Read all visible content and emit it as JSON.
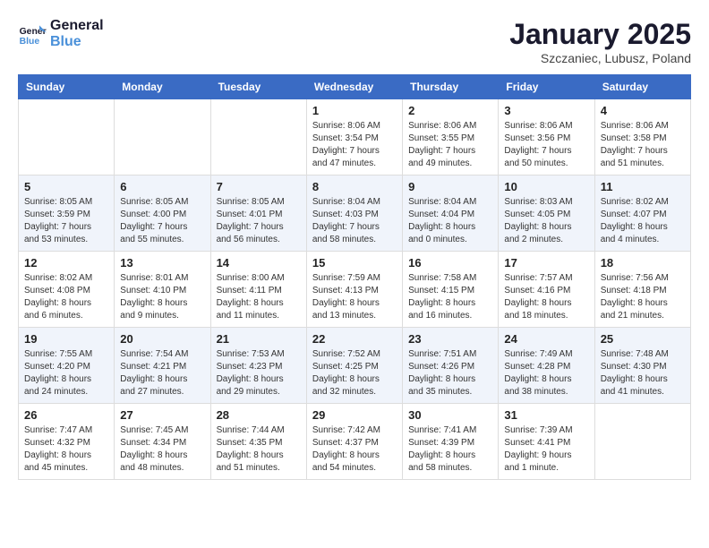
{
  "logo": {
    "line1": "General",
    "line2": "Blue"
  },
  "title": "January 2025",
  "subtitle": "Szczaniec, Lubusz, Poland",
  "weekdays": [
    "Sunday",
    "Monday",
    "Tuesday",
    "Wednesday",
    "Thursday",
    "Friday",
    "Saturday"
  ],
  "weeks": [
    [
      {
        "day": "",
        "info": ""
      },
      {
        "day": "",
        "info": ""
      },
      {
        "day": "",
        "info": ""
      },
      {
        "day": "1",
        "info": "Sunrise: 8:06 AM\nSunset: 3:54 PM\nDaylight: 7 hours\nand 47 minutes."
      },
      {
        "day": "2",
        "info": "Sunrise: 8:06 AM\nSunset: 3:55 PM\nDaylight: 7 hours\nand 49 minutes."
      },
      {
        "day": "3",
        "info": "Sunrise: 8:06 AM\nSunset: 3:56 PM\nDaylight: 7 hours\nand 50 minutes."
      },
      {
        "day": "4",
        "info": "Sunrise: 8:06 AM\nSunset: 3:58 PM\nDaylight: 7 hours\nand 51 minutes."
      }
    ],
    [
      {
        "day": "5",
        "info": "Sunrise: 8:05 AM\nSunset: 3:59 PM\nDaylight: 7 hours\nand 53 minutes."
      },
      {
        "day": "6",
        "info": "Sunrise: 8:05 AM\nSunset: 4:00 PM\nDaylight: 7 hours\nand 55 minutes."
      },
      {
        "day": "7",
        "info": "Sunrise: 8:05 AM\nSunset: 4:01 PM\nDaylight: 7 hours\nand 56 minutes."
      },
      {
        "day": "8",
        "info": "Sunrise: 8:04 AM\nSunset: 4:03 PM\nDaylight: 7 hours\nand 58 minutes."
      },
      {
        "day": "9",
        "info": "Sunrise: 8:04 AM\nSunset: 4:04 PM\nDaylight: 8 hours\nand 0 minutes."
      },
      {
        "day": "10",
        "info": "Sunrise: 8:03 AM\nSunset: 4:05 PM\nDaylight: 8 hours\nand 2 minutes."
      },
      {
        "day": "11",
        "info": "Sunrise: 8:02 AM\nSunset: 4:07 PM\nDaylight: 8 hours\nand 4 minutes."
      }
    ],
    [
      {
        "day": "12",
        "info": "Sunrise: 8:02 AM\nSunset: 4:08 PM\nDaylight: 8 hours\nand 6 minutes."
      },
      {
        "day": "13",
        "info": "Sunrise: 8:01 AM\nSunset: 4:10 PM\nDaylight: 8 hours\nand 9 minutes."
      },
      {
        "day": "14",
        "info": "Sunrise: 8:00 AM\nSunset: 4:11 PM\nDaylight: 8 hours\nand 11 minutes."
      },
      {
        "day": "15",
        "info": "Sunrise: 7:59 AM\nSunset: 4:13 PM\nDaylight: 8 hours\nand 13 minutes."
      },
      {
        "day": "16",
        "info": "Sunrise: 7:58 AM\nSunset: 4:15 PM\nDaylight: 8 hours\nand 16 minutes."
      },
      {
        "day": "17",
        "info": "Sunrise: 7:57 AM\nSunset: 4:16 PM\nDaylight: 8 hours\nand 18 minutes."
      },
      {
        "day": "18",
        "info": "Sunrise: 7:56 AM\nSunset: 4:18 PM\nDaylight: 8 hours\nand 21 minutes."
      }
    ],
    [
      {
        "day": "19",
        "info": "Sunrise: 7:55 AM\nSunset: 4:20 PM\nDaylight: 8 hours\nand 24 minutes."
      },
      {
        "day": "20",
        "info": "Sunrise: 7:54 AM\nSunset: 4:21 PM\nDaylight: 8 hours\nand 27 minutes."
      },
      {
        "day": "21",
        "info": "Sunrise: 7:53 AM\nSunset: 4:23 PM\nDaylight: 8 hours\nand 29 minutes."
      },
      {
        "day": "22",
        "info": "Sunrise: 7:52 AM\nSunset: 4:25 PM\nDaylight: 8 hours\nand 32 minutes."
      },
      {
        "day": "23",
        "info": "Sunrise: 7:51 AM\nSunset: 4:26 PM\nDaylight: 8 hours\nand 35 minutes."
      },
      {
        "day": "24",
        "info": "Sunrise: 7:49 AM\nSunset: 4:28 PM\nDaylight: 8 hours\nand 38 minutes."
      },
      {
        "day": "25",
        "info": "Sunrise: 7:48 AM\nSunset: 4:30 PM\nDaylight: 8 hours\nand 41 minutes."
      }
    ],
    [
      {
        "day": "26",
        "info": "Sunrise: 7:47 AM\nSunset: 4:32 PM\nDaylight: 8 hours\nand 45 minutes."
      },
      {
        "day": "27",
        "info": "Sunrise: 7:45 AM\nSunset: 4:34 PM\nDaylight: 8 hours\nand 48 minutes."
      },
      {
        "day": "28",
        "info": "Sunrise: 7:44 AM\nSunset: 4:35 PM\nDaylight: 8 hours\nand 51 minutes."
      },
      {
        "day": "29",
        "info": "Sunrise: 7:42 AM\nSunset: 4:37 PM\nDaylight: 8 hours\nand 54 minutes."
      },
      {
        "day": "30",
        "info": "Sunrise: 7:41 AM\nSunset: 4:39 PM\nDaylight: 8 hours\nand 58 minutes."
      },
      {
        "day": "31",
        "info": "Sunrise: 7:39 AM\nSunset: 4:41 PM\nDaylight: 9 hours\nand 1 minute."
      },
      {
        "day": "",
        "info": ""
      }
    ]
  ]
}
